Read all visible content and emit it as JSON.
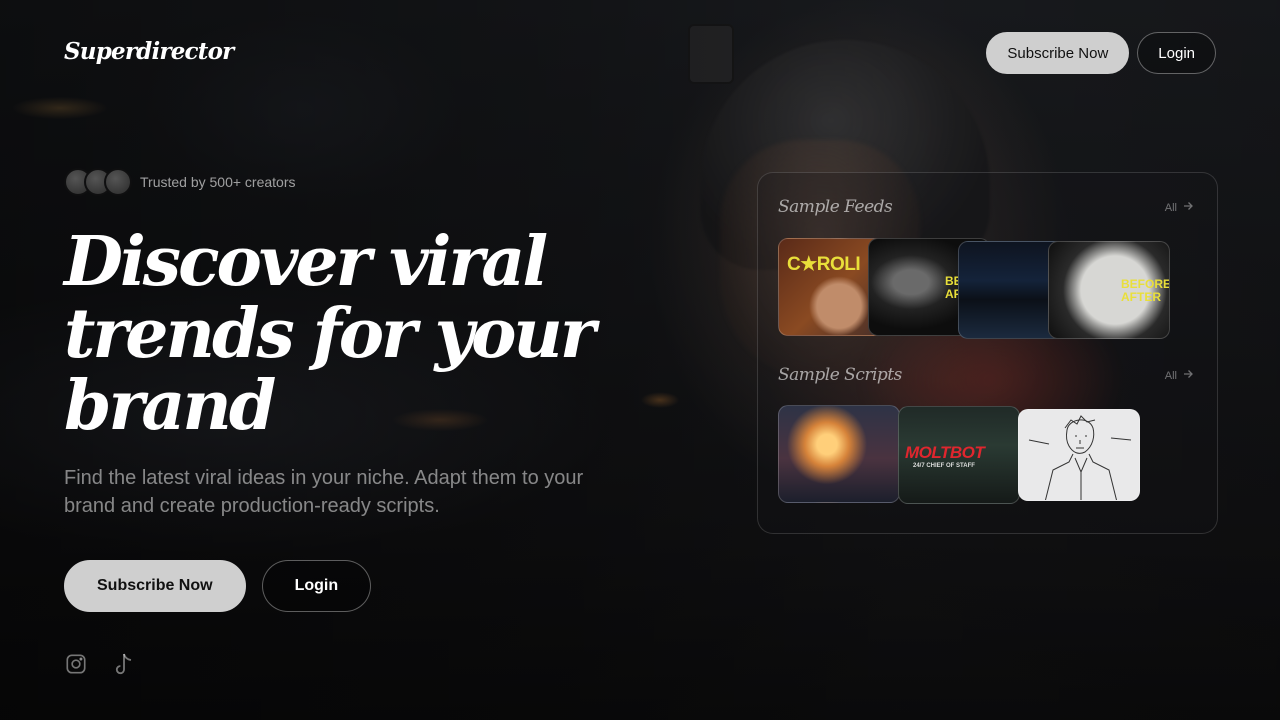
{
  "brand": {
    "logo": "Superdirector"
  },
  "header": {
    "subscribe_label": "Subscribe Now",
    "login_label": "Login"
  },
  "hero": {
    "trusted_text": "Trusted by 500+ creators",
    "headline": "Discover viral trends for your brand",
    "subtext": "Find the latest viral ideas in your niche. Adapt them to your brand and create production-ready scripts.",
    "subscribe_label": "Subscribe Now",
    "login_label": "Login"
  },
  "socials": [
    {
      "icon": "instagram-icon"
    },
    {
      "icon": "tiktok-icon"
    }
  ],
  "samples": {
    "feeds": {
      "title": "Sample Feeds",
      "all_label": "All",
      "thumbnails": [
        {
          "caption": "C★ROLI"
        },
        {
          "caption": "BEFORE AFTER"
        },
        {
          "caption": ""
        },
        {
          "caption": "BEFORE AFTER"
        }
      ]
    },
    "scripts": {
      "title": "Sample Scripts",
      "all_label": "All",
      "thumbnails": [
        {
          "caption": ""
        },
        {
          "caption": "MOLTBOT",
          "subcaption": "24/7 CHIEF OF STAFF"
        },
        {
          "caption": ""
        }
      ]
    }
  },
  "colors": {
    "primary_button": "#cfcfcf",
    "caption_yellow": "#e9df3a",
    "caption_red": "#e0262e"
  }
}
